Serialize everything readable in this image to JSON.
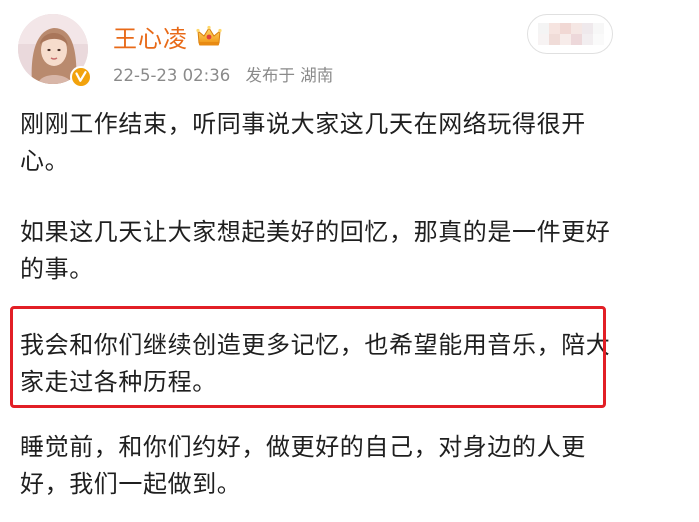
{
  "post": {
    "author": {
      "name": "王心凌",
      "avatar_icon": "avatar-photo",
      "verified_icon": "verified-v-icon",
      "badge_icon": "crown-icon"
    },
    "date": "22-5-23 02:36",
    "location": "发布于 湖南",
    "paragraphs": [
      "刚刚工作结束，听同事说大家这几天在网络玩得很开心。",
      "如果这几天让大家想起美好的回忆，那真的是一件更好的事。",
      "我会和你们继续创造更多记忆，也希望能用音乐，陪大家走过各种历程。",
      "睡觉前，和你们约好，做更好的自己，对身边的人更好，我们一起做到。"
    ]
  },
  "colors": {
    "username": "#e86a18",
    "meta": "#8a8a8a",
    "text": "#1f1f1f",
    "highlight_border": "#e21f26",
    "verified": "#f2a20c"
  }
}
